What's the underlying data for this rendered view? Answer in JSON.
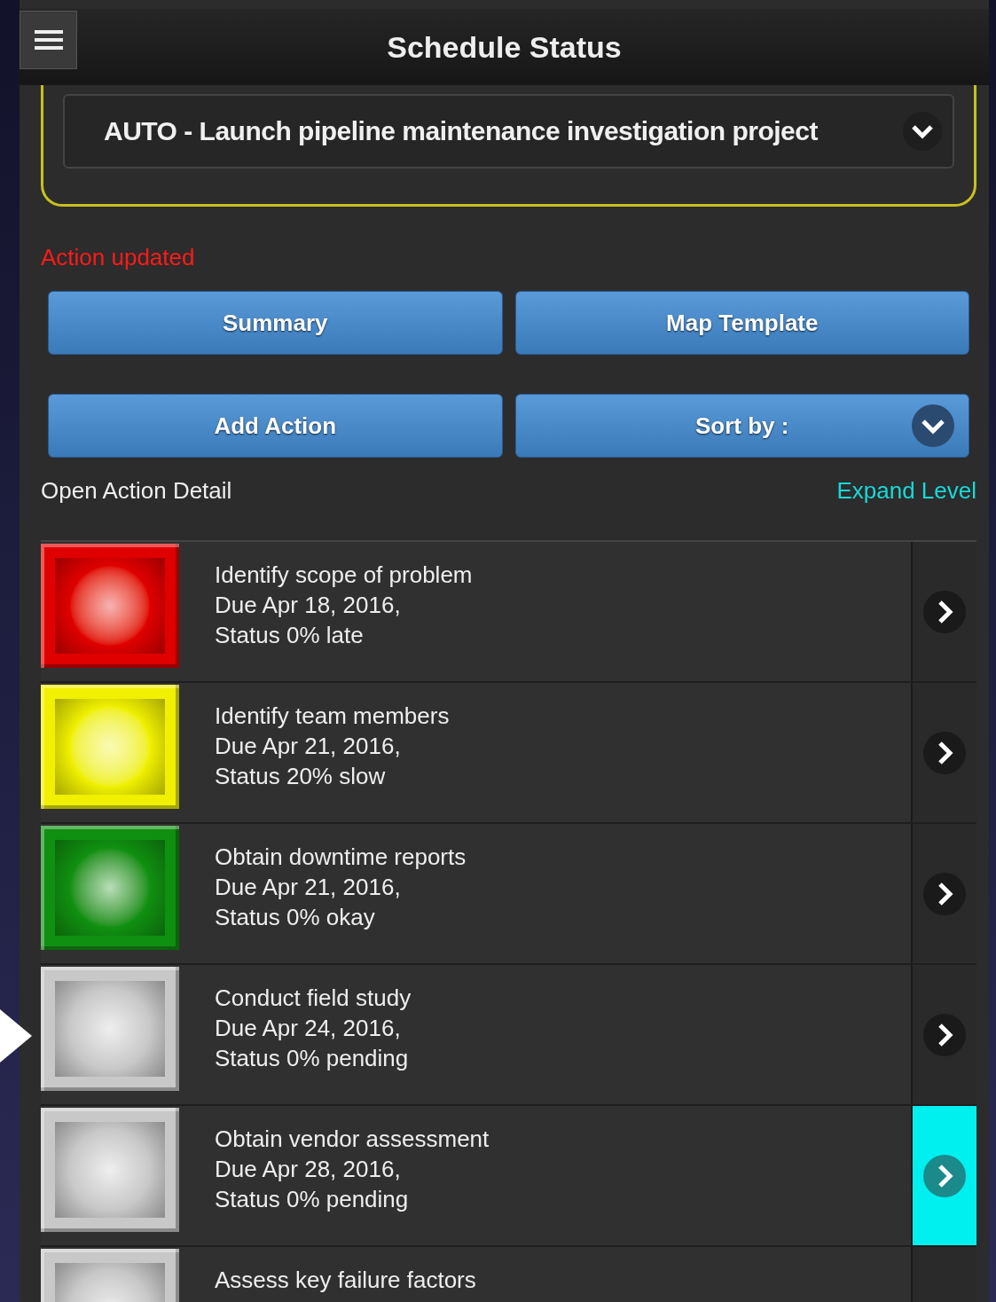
{
  "header": {
    "title": "Schedule Status"
  },
  "project_select": {
    "value": "AUTO - Launch pipeline maintenance investigation project"
  },
  "message": "Action updated",
  "buttons": [
    {
      "label": "Summary",
      "kind": "plain"
    },
    {
      "label": "Map Template",
      "kind": "plain"
    },
    {
      "label": "Add Action",
      "kind": "plain"
    },
    {
      "label": "Sort by :",
      "kind": "dropdown"
    }
  ],
  "section": {
    "title": "Open Action Detail",
    "link": "Expand Level"
  },
  "actions": [
    {
      "title": "Identify scope of problem",
      "due": "Due Apr 18, 2016,",
      "status": "Status 0% late",
      "color": "#e00000",
      "selected": false
    },
    {
      "title": "Identify team members",
      "due": "Due Apr 21, 2016,",
      "status": "Status 20% slow",
      "color": "#f0f000",
      "selected": false
    },
    {
      "title": "Obtain downtime reports",
      "due": "Due Apr 21, 2016,",
      "status": "Status 0% okay",
      "color": "#109010",
      "selected": false
    },
    {
      "title": "Conduct field study",
      "due": "Due Apr 24, 2016,",
      "status": "Status 0% pending",
      "color": "#c8c8c8",
      "selected": false
    },
    {
      "title": "Obtain vendor assessment",
      "due": "Due Apr 28, 2016,",
      "status": "Status 0% pending",
      "color": "#c8c8c8",
      "selected": true
    },
    {
      "title": "Assess key failure factors",
      "color": "#c8c8c8",
      "selected": false
    }
  ]
}
